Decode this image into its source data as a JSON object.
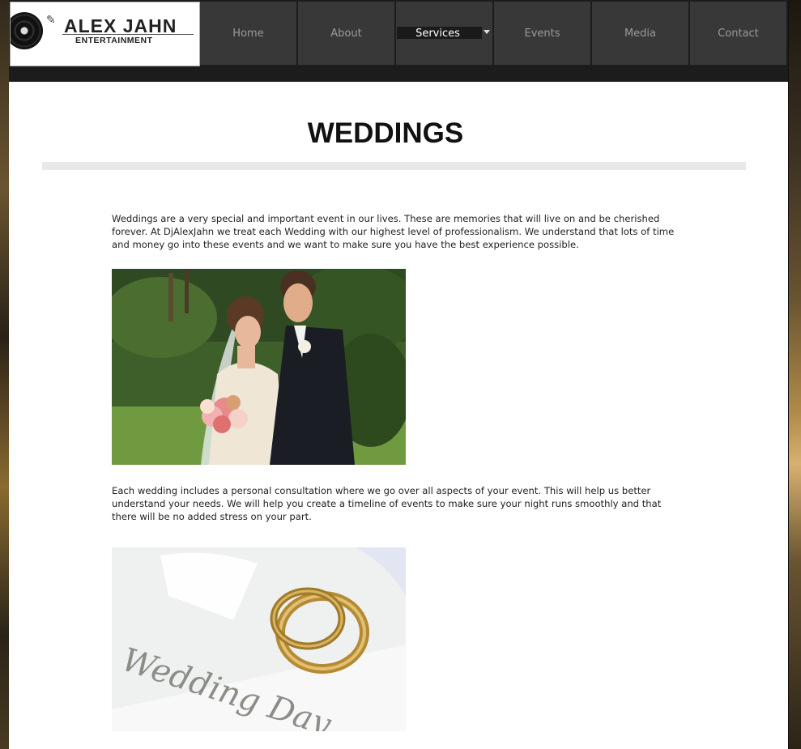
{
  "logo": {
    "title": "ALEX JAHN",
    "subtitle": "ENTERTAINMENT"
  },
  "nav": {
    "items": [
      {
        "label": "Home"
      },
      {
        "label": "About"
      },
      {
        "label": "Services"
      },
      {
        "label": "Events"
      },
      {
        "label": "Media"
      },
      {
        "label": "Contact"
      }
    ],
    "active": "Services"
  },
  "page": {
    "heading": "WEDDINGS",
    "para1": "Weddings are a very special and important event in our lives.  These are memories that will live on and be cherished forever.  At DjAlexJahn we treat each Wedding with our highest level of professionalism.  We understand that lots of time and money go into these events and we want to make sure you have the best experience possible.",
    "para2": "Each wedding includes a personal consultation where we go over all aspects of your event.  This will help us better understand your needs.  We will help you create a timeline of events to make sure your night runs smoothly and that there will be no added stress on your part.",
    "image2_caption": "Wedding Day"
  },
  "colors": {
    "nav_bg": "#383838",
    "nav_text": "#9a9a9a",
    "nav_active_text": "#ffffff",
    "header_bg": "#1c1c1c"
  }
}
